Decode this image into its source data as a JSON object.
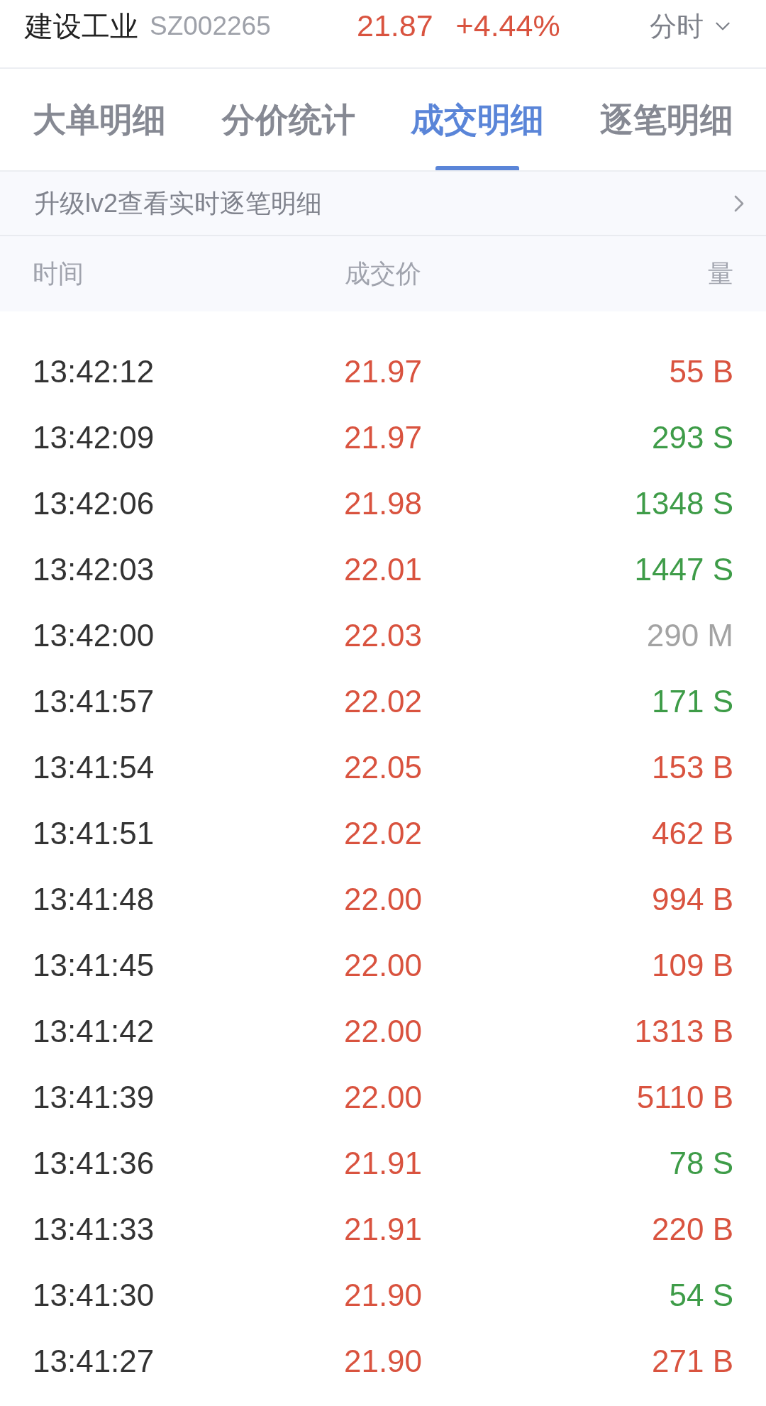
{
  "header": {
    "stock_name": "建设工业",
    "stock_code": "SZ002265",
    "price": "21.87",
    "change": "+4.44%",
    "up": true,
    "period_selector": {
      "label": "分时"
    }
  },
  "tabs": [
    {
      "label": "大单明细",
      "selected": false
    },
    {
      "label": "分价统计",
      "selected": false
    },
    {
      "label": "成交明细",
      "selected": true
    },
    {
      "label": "逐笔明细",
      "selected": false
    }
  ],
  "upgrade_banner": {
    "text": "升级lv2查看实时逐笔明细"
  },
  "table": {
    "columns": [
      "时间",
      "成交价",
      "量"
    ],
    "rows": [
      {
        "time": "13:42:12",
        "price": "21.97",
        "price_up": true,
        "volume": "55 B",
        "kind": "buy"
      },
      {
        "time": "13:42:09",
        "price": "21.97",
        "price_up": true,
        "volume": "293 S",
        "kind": "sell"
      },
      {
        "time": "13:42:06",
        "price": "21.98",
        "price_up": true,
        "volume": "1348 S",
        "kind": "sell"
      },
      {
        "time": "13:42:03",
        "price": "22.01",
        "price_up": true,
        "volume": "1447 S",
        "kind": "sell"
      },
      {
        "time": "13:42:00",
        "price": "22.03",
        "price_up": true,
        "volume": "290 M",
        "kind": "neutral"
      },
      {
        "time": "13:41:57",
        "price": "22.02",
        "price_up": true,
        "volume": "171 S",
        "kind": "sell"
      },
      {
        "time": "13:41:54",
        "price": "22.05",
        "price_up": true,
        "volume": "153 B",
        "kind": "buy"
      },
      {
        "time": "13:41:51",
        "price": "22.02",
        "price_up": true,
        "volume": "462 B",
        "kind": "buy"
      },
      {
        "time": "13:41:48",
        "price": "22.00",
        "price_up": true,
        "volume": "994 B",
        "kind": "buy"
      },
      {
        "time": "13:41:45",
        "price": "22.00",
        "price_up": true,
        "volume": "109 B",
        "kind": "buy"
      },
      {
        "time": "13:41:42",
        "price": "22.00",
        "price_up": true,
        "volume": "1313 B",
        "kind": "buy"
      },
      {
        "time": "13:41:39",
        "price": "22.00",
        "price_up": true,
        "volume": "5110 B",
        "kind": "buy"
      },
      {
        "time": "13:41:36",
        "price": "21.91",
        "price_up": true,
        "volume": "78 S",
        "kind": "sell"
      },
      {
        "time": "13:41:33",
        "price": "21.91",
        "price_up": true,
        "volume": "220 B",
        "kind": "buy"
      },
      {
        "time": "13:41:30",
        "price": "21.90",
        "price_up": true,
        "volume": "54 S",
        "kind": "sell"
      },
      {
        "time": "13:41:27",
        "price": "21.90",
        "price_up": true,
        "volume": "271 B",
        "kind": "buy"
      }
    ]
  }
}
